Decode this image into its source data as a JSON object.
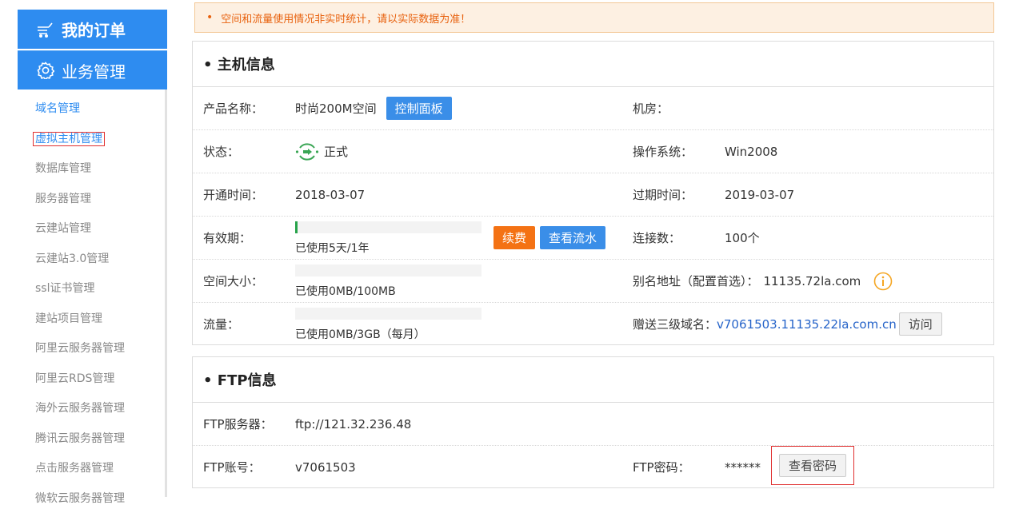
{
  "sidebar": {
    "my_orders": "我的订单",
    "business": "业务管理",
    "items": [
      "域名管理",
      "虚拟主机管理",
      "数据库管理",
      "服务器管理",
      "云建站管理",
      "云建站3.0管理",
      "ssl证书管理",
      "建站项目管理",
      "阿里云服务器管理",
      "阿里云RDS管理",
      "海外云服务器管理",
      "腾讯云服务器管理",
      "点击服务器管理",
      "微软云服务器管理"
    ]
  },
  "notice": {
    "dot": "•",
    "text": "空间和流量使用情况非实时统计，请以实际数据为准！"
  },
  "host": {
    "title": "• 主机信息",
    "product_label": "产品名称：",
    "product_value": "时尚200M空间",
    "control_panel": "控制面板",
    "room_label": "机房：",
    "status_label": "状态：",
    "status_value": "正式",
    "os_label": "操作系统：",
    "os_value": "Win2008",
    "open_label": "开通时间：",
    "open_value": "2018-03-07",
    "expire_label": "过期时间：",
    "expire_value": "2019-03-07",
    "validity_label": "有效期：",
    "validity_used": 0.014,
    "validity_text": "已使用5天/1年",
    "renew": "续费",
    "view_flow": "查看流水",
    "conn_label": "连接数：",
    "conn_value": "100个",
    "space_label": "空间大小：",
    "space_used": 0,
    "space_text": "已使用0MB/100MB",
    "alias_label": "别名地址（配置首选）：",
    "alias_value": "11135.72la.com",
    "traffic_label": "流量：",
    "traffic_used": 0,
    "traffic_text": "已使用0MB/3GB（每月）",
    "domain_label": "赠送三级域名：",
    "domain_value": "v7061503.11135.22la.com.cn",
    "visit": "访问"
  },
  "ftp": {
    "title": "• FTP信息",
    "server_label": "FTP服务器：",
    "server_value": "ftp://121.32.236.48",
    "account_label": "FTP账号：",
    "account_value": "v7061503",
    "password_label": "FTP密码：",
    "password_value": "******",
    "view_password": "查看密码"
  },
  "colors": {
    "primary": "#2e8cf0",
    "orange": "#f47214",
    "notice_text": "#e8620f",
    "progress": "#27a34a"
  }
}
